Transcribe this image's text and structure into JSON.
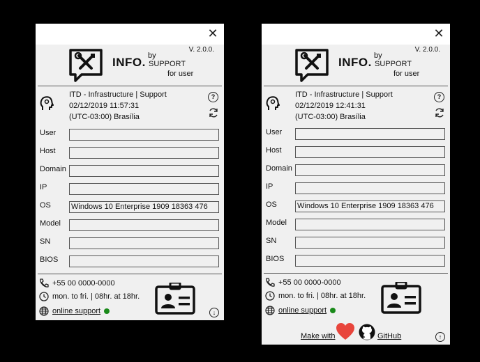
{
  "app": {
    "brand": "INFO.",
    "by": "by",
    "support": "SUPPORT",
    "for_user": "for user",
    "version": "V. 2.0.0.",
    "close_glyph": "✕",
    "help_glyph": "?",
    "accent_green": "#1a8a1a",
    "heart_color": "#e8453c"
  },
  "labels": {
    "user": "User",
    "host": "Host",
    "domain": "Domain",
    "ip": "IP",
    "os": "OS",
    "model": "Model",
    "sn": "SN",
    "bios": "BIOS"
  },
  "contact": {
    "phone": "+55 00 0000-0000",
    "hours": "mon. to fri. | 08hr. at 18hr.",
    "online_support": "online support"
  },
  "left": {
    "department": "ITD - Infrastructure | Support",
    "datetime": "02/12/2019 11:57:31",
    "timezone": "(UTC-03:00) Brasília",
    "fields": {
      "user": "",
      "host": "",
      "domain": "",
      "ip": "",
      "os": "Windows 10 Enterprise 1909 18363 476",
      "model": "",
      "sn": "",
      "bios": ""
    },
    "toggle_glyph": "↓"
  },
  "right": {
    "department": "ITD - Infrastructure | Support",
    "datetime": "02/12/2019 12:41:31",
    "timezone": "(UTC-03:00) Brasília",
    "fields": {
      "user": "",
      "host": "",
      "domain": "",
      "ip": "",
      "os": "Windows 10 Enterprise 1909 18363 476",
      "model": "",
      "sn": "",
      "bios": ""
    },
    "footer": {
      "make_with": "Make with",
      "github": "GitHub"
    },
    "toggle_glyph": "↑"
  }
}
